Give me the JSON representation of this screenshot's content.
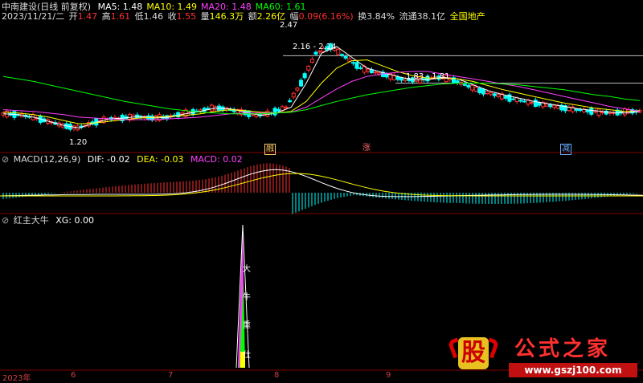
{
  "header": {
    "stock_name": "中南建设",
    "period": "(日线 前复权)",
    "date": "2023/11/21/二",
    "open_label": "开",
    "open": "1.47",
    "high_label": "高",
    "high": "1.61",
    "low_label": "低",
    "low": "1.46",
    "close_label": "收",
    "close": "1.55",
    "volume_label": "量",
    "volume": "146.3万",
    "amount_label": "额",
    "amount": "2.26亿",
    "change_label": "幅",
    "change": "0.09(6.16%)",
    "turnover_label": "换",
    "turnover": "3.84%",
    "float_label": "流通",
    "float_cap": "38.1亿",
    "sector": "全国地产"
  },
  "ma_legend": [
    {
      "label": "MA5: 1.48",
      "color": "#ffffff"
    },
    {
      "label": "MA10: 1.49",
      "color": "#ffff00"
    },
    {
      "label": "MA20: 1.48",
      "color": "#ff40ff"
    },
    {
      "label": "MA60: 1.61",
      "color": "#00ff00"
    }
  ],
  "price_annotations": {
    "high_mark": "2.47",
    "low_mark": "1.20",
    "range1": "2.16 - 2.14",
    "range2": "1.83 - 1.81"
  },
  "event_tags": [
    {
      "label": "融",
      "color": "#ffcc66"
    },
    {
      "label": "涨",
      "color": "#ff6666"
    },
    {
      "label": "减",
      "color": "#66aaff"
    }
  ],
  "macd_panel": {
    "title": "MACD(12,26,9)",
    "dif": "DIF: -0.02",
    "dea": "DEA: -0.03",
    "macd": "MACD: 0.02"
  },
  "indicator_panel": {
    "title": "红主大牛",
    "xg": "XG: 0.00",
    "spike_chars": [
      "大",
      "牛",
      "重",
      "仕"
    ]
  },
  "x_axis": [
    "2023年",
    "6",
    "7",
    "8",
    "9"
  ],
  "watermark": {
    "big_char": "股",
    "title": "公式之家",
    "url": "www.gszj100.com"
  },
  "colors": {
    "up": "#ff3030",
    "down": "#00ffff",
    "grid": "#800000"
  },
  "chart_data": {
    "type": "line",
    "series": [
      {
        "name": "MA5",
        "values": [
          1.45,
          1.44,
          1.41,
          1.36,
          1.31,
          1.28,
          1.34,
          1.39,
          1.4,
          1.42,
          1.4,
          1.41,
          1.45,
          1.48,
          1.52,
          1.51,
          1.47,
          1.43,
          1.46,
          1.53,
          1.82,
          2.18,
          2.26,
          2.13,
          2.0,
          1.95,
          1.9,
          1.86,
          1.86,
          1.89,
          1.87,
          1.8,
          1.73,
          1.68,
          1.64,
          1.6,
          1.57,
          1.54,
          1.51,
          1.49,
          1.47,
          1.46,
          1.48
        ]
      },
      {
        "name": "MA10",
        "values": [
          1.47,
          1.46,
          1.44,
          1.41,
          1.37,
          1.33,
          1.34,
          1.36,
          1.38,
          1.4,
          1.41,
          1.42,
          1.43,
          1.45,
          1.48,
          1.5,
          1.49,
          1.47,
          1.46,
          1.48,
          1.6,
          1.82,
          2.0,
          2.09,
          2.1,
          2.03,
          1.96,
          1.91,
          1.88,
          1.88,
          1.87,
          1.84,
          1.79,
          1.74,
          1.7,
          1.66,
          1.62,
          1.58,
          1.55,
          1.52,
          1.5,
          1.48,
          1.49
        ]
      },
      {
        "name": "MA20",
        "values": [
          1.5,
          1.49,
          1.48,
          1.46,
          1.44,
          1.41,
          1.4,
          1.39,
          1.38,
          1.38,
          1.38,
          1.39,
          1.4,
          1.41,
          1.43,
          1.45,
          1.46,
          1.46,
          1.46,
          1.47,
          1.53,
          1.64,
          1.75,
          1.84,
          1.9,
          1.93,
          1.95,
          1.96,
          1.96,
          1.93,
          1.9,
          1.87,
          1.84,
          1.81,
          1.78,
          1.74,
          1.7,
          1.66,
          1.62,
          1.58,
          1.54,
          1.51,
          1.48
        ]
      },
      {
        "name": "MA60",
        "values": [
          1.9,
          1.87,
          1.84,
          1.8,
          1.76,
          1.72,
          1.68,
          1.64,
          1.6,
          1.57,
          1.54,
          1.51,
          1.49,
          1.47,
          1.46,
          1.45,
          1.45,
          1.45,
          1.46,
          1.47,
          1.5,
          1.55,
          1.6,
          1.64,
          1.68,
          1.71,
          1.74,
          1.77,
          1.79,
          1.81,
          1.82,
          1.82,
          1.82,
          1.81,
          1.8,
          1.78,
          1.76,
          1.74,
          1.71,
          1.68,
          1.66,
          1.63,
          1.61
        ]
      }
    ],
    "ylim": [
      1.1,
      2.55
    ],
    "grid": false,
    "legend": "top-left"
  }
}
